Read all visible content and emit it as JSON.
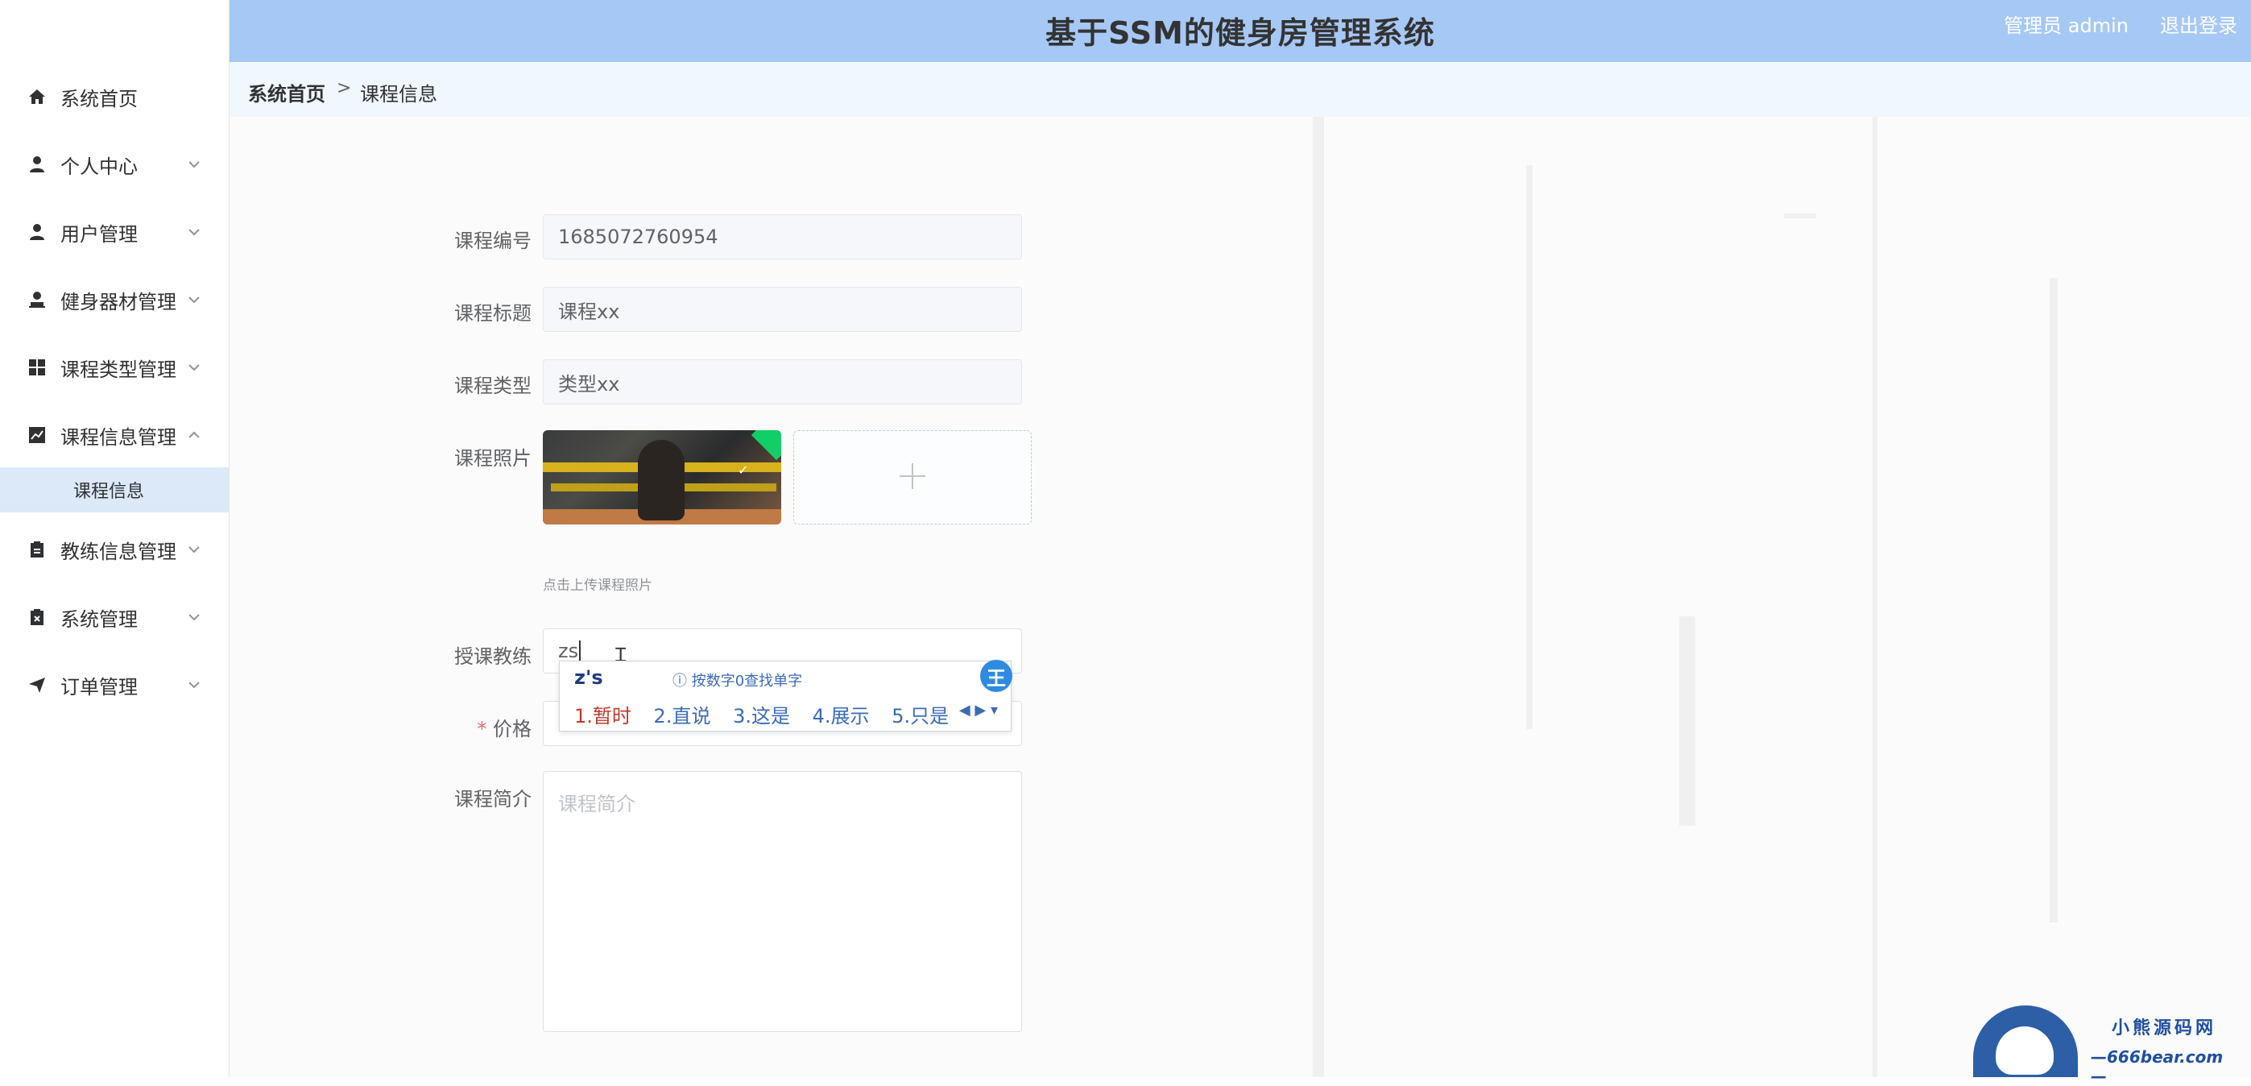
{
  "header": {
    "title": "基于SSM的健身房管理系统",
    "user": "管理员 admin",
    "logout": "退出登录"
  },
  "sidebar": {
    "items": [
      {
        "label": "系统首页",
        "icon": "home-icon"
      },
      {
        "label": "个人中心",
        "icon": "user-icon"
      },
      {
        "label": "用户管理",
        "icon": "user-icon"
      },
      {
        "label": "健身器材管理",
        "icon": "user-stamp-icon"
      },
      {
        "label": "课程类型管理",
        "icon": "grid-icon"
      },
      {
        "label": "课程信息管理",
        "icon": "chart-icon"
      },
      {
        "label": "教练信息管理",
        "icon": "clipboard-icon"
      },
      {
        "label": "系统管理",
        "icon": "clipboard-x-icon"
      },
      {
        "label": "订单管理",
        "icon": "send-icon"
      }
    ],
    "sub_active": "课程信息"
  },
  "breadcrumb": {
    "home": "系统首页",
    "sep": ">",
    "current": "课程信息"
  },
  "form": {
    "course_no_label": "课程编号",
    "course_no_value": "1685072760954",
    "course_title_label": "课程标题",
    "course_title_value": "课程xx",
    "course_type_label": "课程类型",
    "course_type_value": "类型xx",
    "course_photo_label": "课程照片",
    "upload_hint": "点击上传课程照片",
    "coach_label": "授课教练",
    "coach_value": "zs",
    "price_required": "*",
    "price_label": "价格",
    "intro_label": "课程简介",
    "intro_placeholder": "课程简介"
  },
  "ime": {
    "composition": "z's",
    "help": "按数字0查找单字",
    "candidates": [
      "1.暂时",
      "2.直说",
      "3.这是",
      "4.展示",
      "5.只是"
    ],
    "logo": "王"
  },
  "watermark": {
    "line1": "小熊源码网",
    "line2": "—666bear.com—"
  },
  "colors": {
    "header_bg": "#a6c8f5",
    "sidebar_active_bg": "#dbe9f8",
    "required": "#f56c6c"
  }
}
